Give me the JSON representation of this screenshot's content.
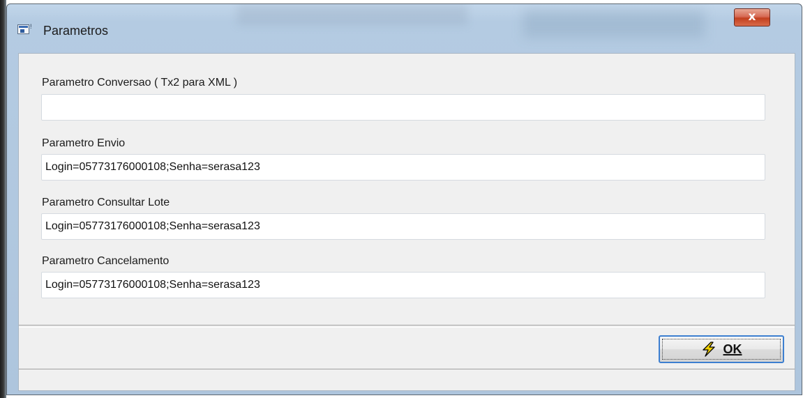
{
  "window": {
    "title": "Parametros",
    "close_label": "x"
  },
  "fields": [
    {
      "label": "Parametro Conversao ( Tx2 para XML )",
      "value": ""
    },
    {
      "label": "Parametro Envio",
      "value": "Login=05773176000108;Senha=serasa123"
    },
    {
      "label": "Parametro Consultar Lote",
      "value": "Login=05773176000108;Senha=serasa123"
    },
    {
      "label": "Parametro Cancelamento",
      "value": "Login=05773176000108;Senha=serasa123"
    }
  ],
  "footer": {
    "ok_label": "OK",
    "ok_icon": "lightning-icon"
  },
  "colors": {
    "close_button": "#c84a2c",
    "focus_border": "#3d7fd0",
    "dialog_background": "#f0f0f0"
  }
}
